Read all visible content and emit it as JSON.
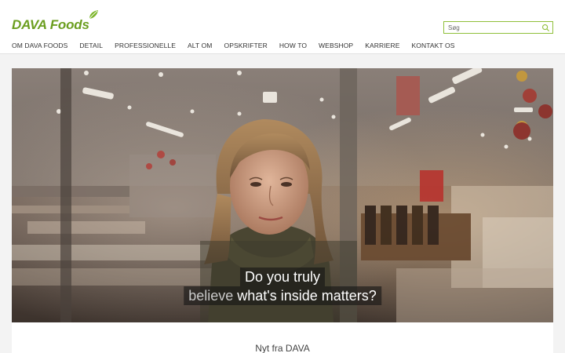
{
  "brand": {
    "name": "DAVA Foods",
    "accent": "#6b9e1f"
  },
  "search": {
    "placeholder": "Søg",
    "icon": "search-icon"
  },
  "nav": {
    "items": [
      {
        "label": "OM DAVA FOODS"
      },
      {
        "label": "DETAIL"
      },
      {
        "label": "PROFESSIONELLE"
      },
      {
        "label": "ALT OM"
      },
      {
        "label": "OPSKRIFTER"
      },
      {
        "label": "HOW TO"
      },
      {
        "label": "WEBSHOP"
      },
      {
        "label": "KARRIERE"
      },
      {
        "label": "KONTAKT OS"
      }
    ]
  },
  "hero": {
    "subtitle_line1": "Do you truly",
    "subtitle_line2_dim": "believe",
    "subtitle_line2_rest": " what's inside matters?"
  },
  "news": {
    "title": "Nyt fra DAVA"
  }
}
